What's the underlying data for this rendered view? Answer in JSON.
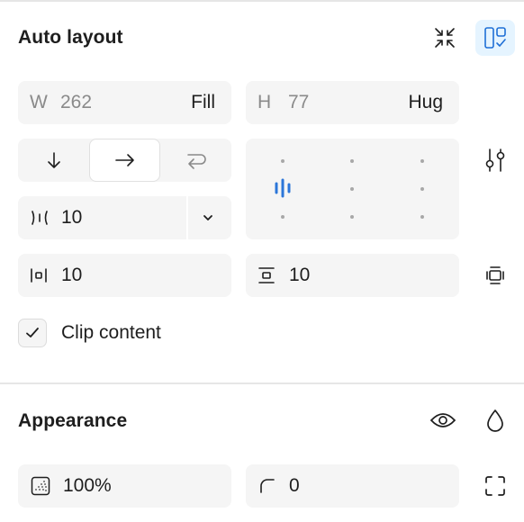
{
  "auto_layout": {
    "title": "Auto layout",
    "icons": {
      "resize": "collapse-arrows-icon",
      "layout_mode": "layout-check-icon"
    },
    "width": {
      "prefix": "W",
      "value": "262",
      "mode": "Fill"
    },
    "height": {
      "prefix": "H",
      "value": "77",
      "mode": "Hug"
    },
    "direction": {
      "options": [
        "vertical-arrow-icon",
        "horizontal-arrow-icon",
        "wrap-arrow-icon"
      ],
      "selected_index": 1
    },
    "alignment": {
      "selected": "left-center"
    },
    "gap": {
      "value": "10",
      "dropdown": "chevron-down-icon"
    },
    "padding_horizontal": {
      "value": "10"
    },
    "padding_vertical": {
      "value": "10"
    },
    "clip_content": {
      "label": "Clip content",
      "checked": true
    },
    "accent_color": "#2c76d9"
  },
  "appearance": {
    "title": "Appearance",
    "opacity": {
      "value": "100%"
    },
    "corner_radius": {
      "value": "0"
    },
    "icons": {
      "visibility": "eye-icon",
      "blend": "drop-icon",
      "corners": "corners-expand-icon"
    }
  }
}
